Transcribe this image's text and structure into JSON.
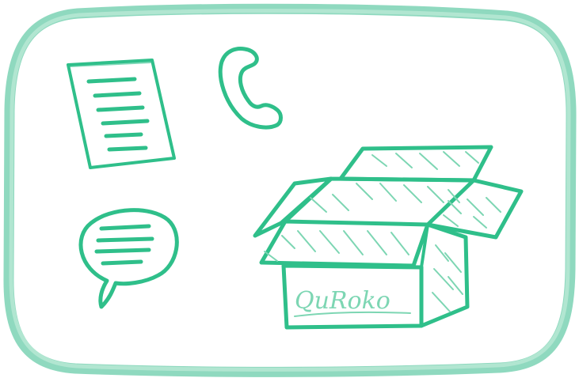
{
  "illustration": {
    "brand_text": "QuRoko",
    "icons": [
      "document-icon",
      "phone-icon",
      "chat-bubble-icon",
      "box-icon"
    ],
    "colors": {
      "frame": "#8fd9bf",
      "ink": "#2fbf8a",
      "ink_light": "#7dd6b3",
      "background": "#ffffff"
    }
  }
}
